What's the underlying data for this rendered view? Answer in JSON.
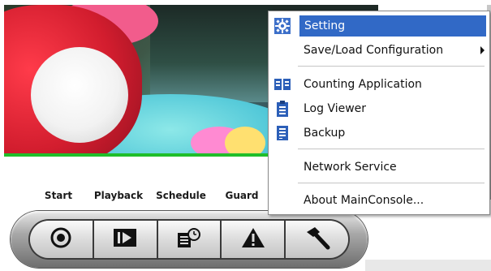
{
  "controls": {
    "labels": {
      "start": "Start",
      "playback": "Playback",
      "schedule": "Schedule",
      "guard": "Guard"
    },
    "buttons": [
      {
        "name": "start",
        "icon": "record-icon"
      },
      {
        "name": "playback",
        "icon": "playback-icon"
      },
      {
        "name": "schedule",
        "icon": "schedule-icon"
      },
      {
        "name": "guard",
        "icon": "warning-icon"
      },
      {
        "name": "tools",
        "icon": "hammer-icon"
      }
    ]
  },
  "menu": {
    "items": [
      {
        "label": "Setting",
        "icon": "gear-icon",
        "highlighted": true
      },
      {
        "label": "Save/Load Configuration",
        "has_submenu": true
      },
      {
        "label": "Counting Application",
        "icon": "counting-icon"
      },
      {
        "label": "Log Viewer",
        "icon": "log-icon"
      },
      {
        "label": "Backup",
        "icon": "backup-icon"
      },
      {
        "label": "Network Service"
      },
      {
        "label": "About MainConsole..."
      }
    ]
  },
  "colors": {
    "highlight": "#3169c6",
    "video_border": "#1fbe2a"
  }
}
